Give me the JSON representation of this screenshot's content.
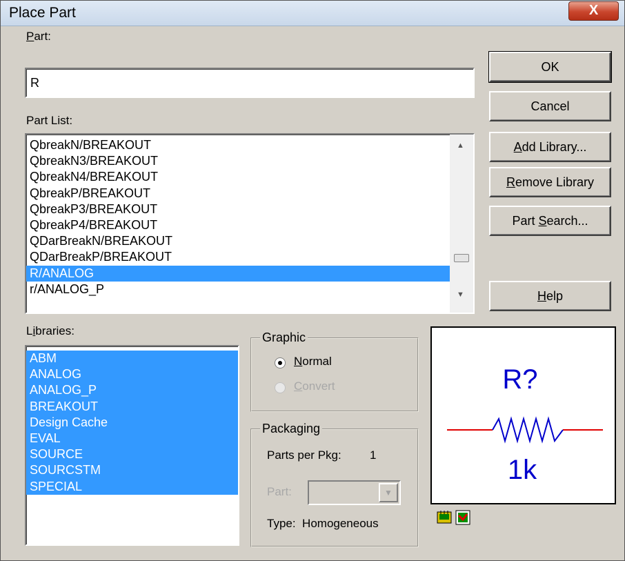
{
  "window": {
    "title": "Place Part",
    "close_label": "X"
  },
  "part": {
    "label": "Part:",
    "value": "R"
  },
  "part_list": {
    "label": "Part List:",
    "items": [
      "QbreakN/BREAKOUT",
      "QbreakN3/BREAKOUT",
      "QbreakN4/BREAKOUT",
      "QbreakP/BREAKOUT",
      "QbreakP3/BREAKOUT",
      "QbreakP4/BREAKOUT",
      "QDarBreakN/BREAKOUT",
      "QDarBreakP/BREAKOUT",
      "R/ANALOG",
      "r/ANALOG_P"
    ],
    "selected": "R/ANALOG"
  },
  "libraries": {
    "label": "Libraries:",
    "items": [
      "ABM",
      "ANALOG",
      "ANALOG_P",
      "BREAKOUT",
      "Design Cache",
      "EVAL",
      "SOURCE",
      "SOURCSTM",
      "SPECIAL"
    ]
  },
  "buttons": {
    "ok": "OK",
    "cancel": "Cancel",
    "add_library": "Add Library...",
    "remove_library": "Remove Library",
    "part_search": "Part Search...",
    "help": "Help"
  },
  "graphic": {
    "title": "Graphic",
    "normal": "Normal",
    "convert": "Convert",
    "selected": "Normal"
  },
  "packaging": {
    "title": "Packaging",
    "parts_per_pkg_label": "Parts per Pkg:",
    "parts_per_pkg_value": "1",
    "part_label": "Part:",
    "type_label": "Type:",
    "type_value": "Homogeneous"
  },
  "preview": {
    "refdes": "R?",
    "value": "1k",
    "lead_color": "#e00000",
    "body_color": "#0000cc"
  },
  "icons": [
    "pcb-footprint-icon",
    "part-preview-toggle-icon"
  ]
}
